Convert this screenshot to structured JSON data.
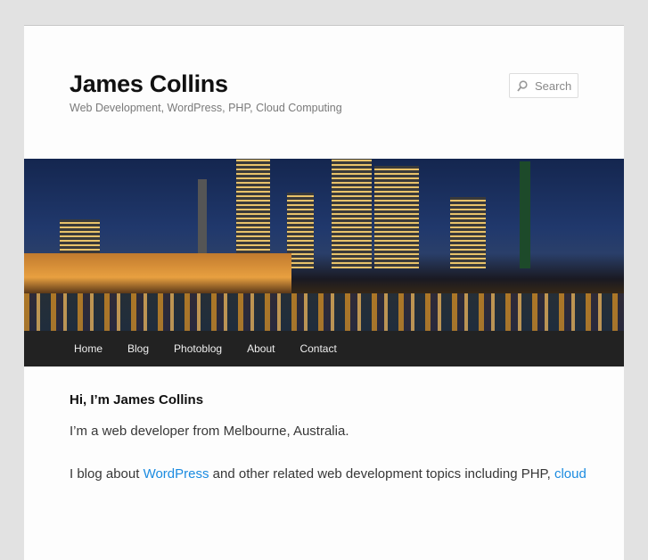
{
  "site": {
    "title": "James Collins",
    "description": "Web Development, WordPress, PHP, Cloud Computing"
  },
  "search": {
    "placeholder": "Search",
    "icon": "search-icon"
  },
  "nav": [
    "Home",
    "Blog",
    "Photoblog",
    "About",
    "Contact"
  ],
  "content": {
    "heading": "Hi, I’m James Collins",
    "p1": "I’m a web developer from Melbourne, Australia.",
    "p2_pre": "I blog about ",
    "p2_link1": "WordPress",
    "p2_mid": " and other related web development topics including PHP, ",
    "p2_link2": "cloud"
  },
  "colors": {
    "link": "#1b8be0",
    "nav_bg": "#222222"
  }
}
